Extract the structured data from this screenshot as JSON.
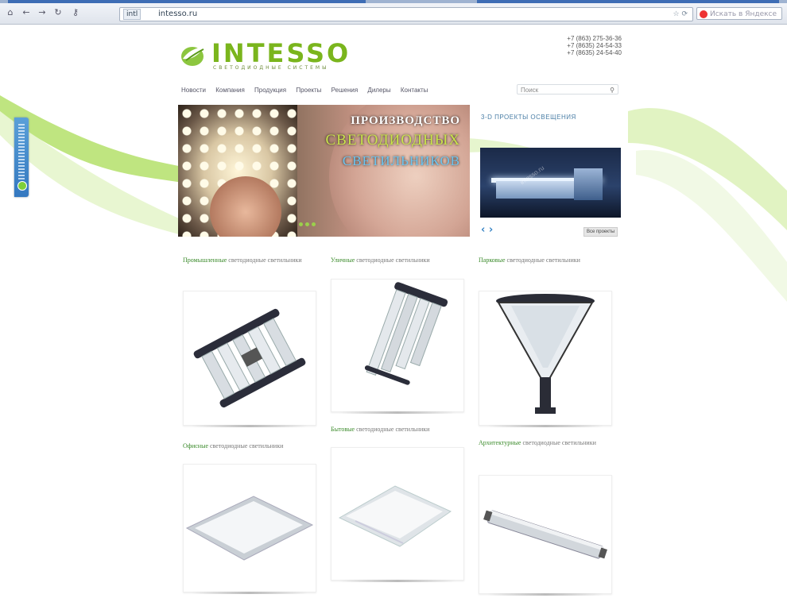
{
  "browser": {
    "url_prefix": "intl",
    "url": "intesso.ru",
    "search_placeholder": "Искать в Яндексе"
  },
  "site": {
    "logo_text": "INTESSO",
    "logo_sub": "СВЕТОДИОДНЫЕ СИСТЕМЫ",
    "phones": [
      "+7 (863) 275-36-36",
      "+7 (8635) 24-54-33",
      "+7 (8635) 24-54-40"
    ],
    "menu": [
      "Новости",
      "Компания",
      "Продукция",
      "Проекты",
      "Решения",
      "Дилеры",
      "Контакты"
    ],
    "search_placeholder": "Поиск"
  },
  "banner": {
    "line1": "ПРОИЗВОДСТВО",
    "line2": "СВЕТОДИОДНЫХ",
    "line3": "СВЕТИЛЬНИКОВ"
  },
  "projects": {
    "title": "3-D ПРОЕКТЫ ОСВЕЩЕНИЯ",
    "watermark": "intesso.ru",
    "prev": "‹",
    "next": "›",
    "all_label": "Все проекты"
  },
  "categories": [
    {
      "bold": "Промышленные",
      "rest": " светодиодные светильники"
    },
    {
      "bold": "Уличные",
      "rest": " светодиодные светильники"
    },
    {
      "bold": "Парковые",
      "rest": " светодиодные светильники"
    },
    {
      "bold": "Офисные",
      "rest": " светодиодные светильники"
    },
    {
      "bold": "Бытовые",
      "rest": " светодиодные светильники"
    },
    {
      "bold": "Архитектурные",
      "rest": " светодиодные светильники"
    }
  ],
  "colors": {
    "brand_green": "#7ab51d",
    "link_green": "#3a8a2a",
    "accent_blue": "#3b86c6"
  }
}
